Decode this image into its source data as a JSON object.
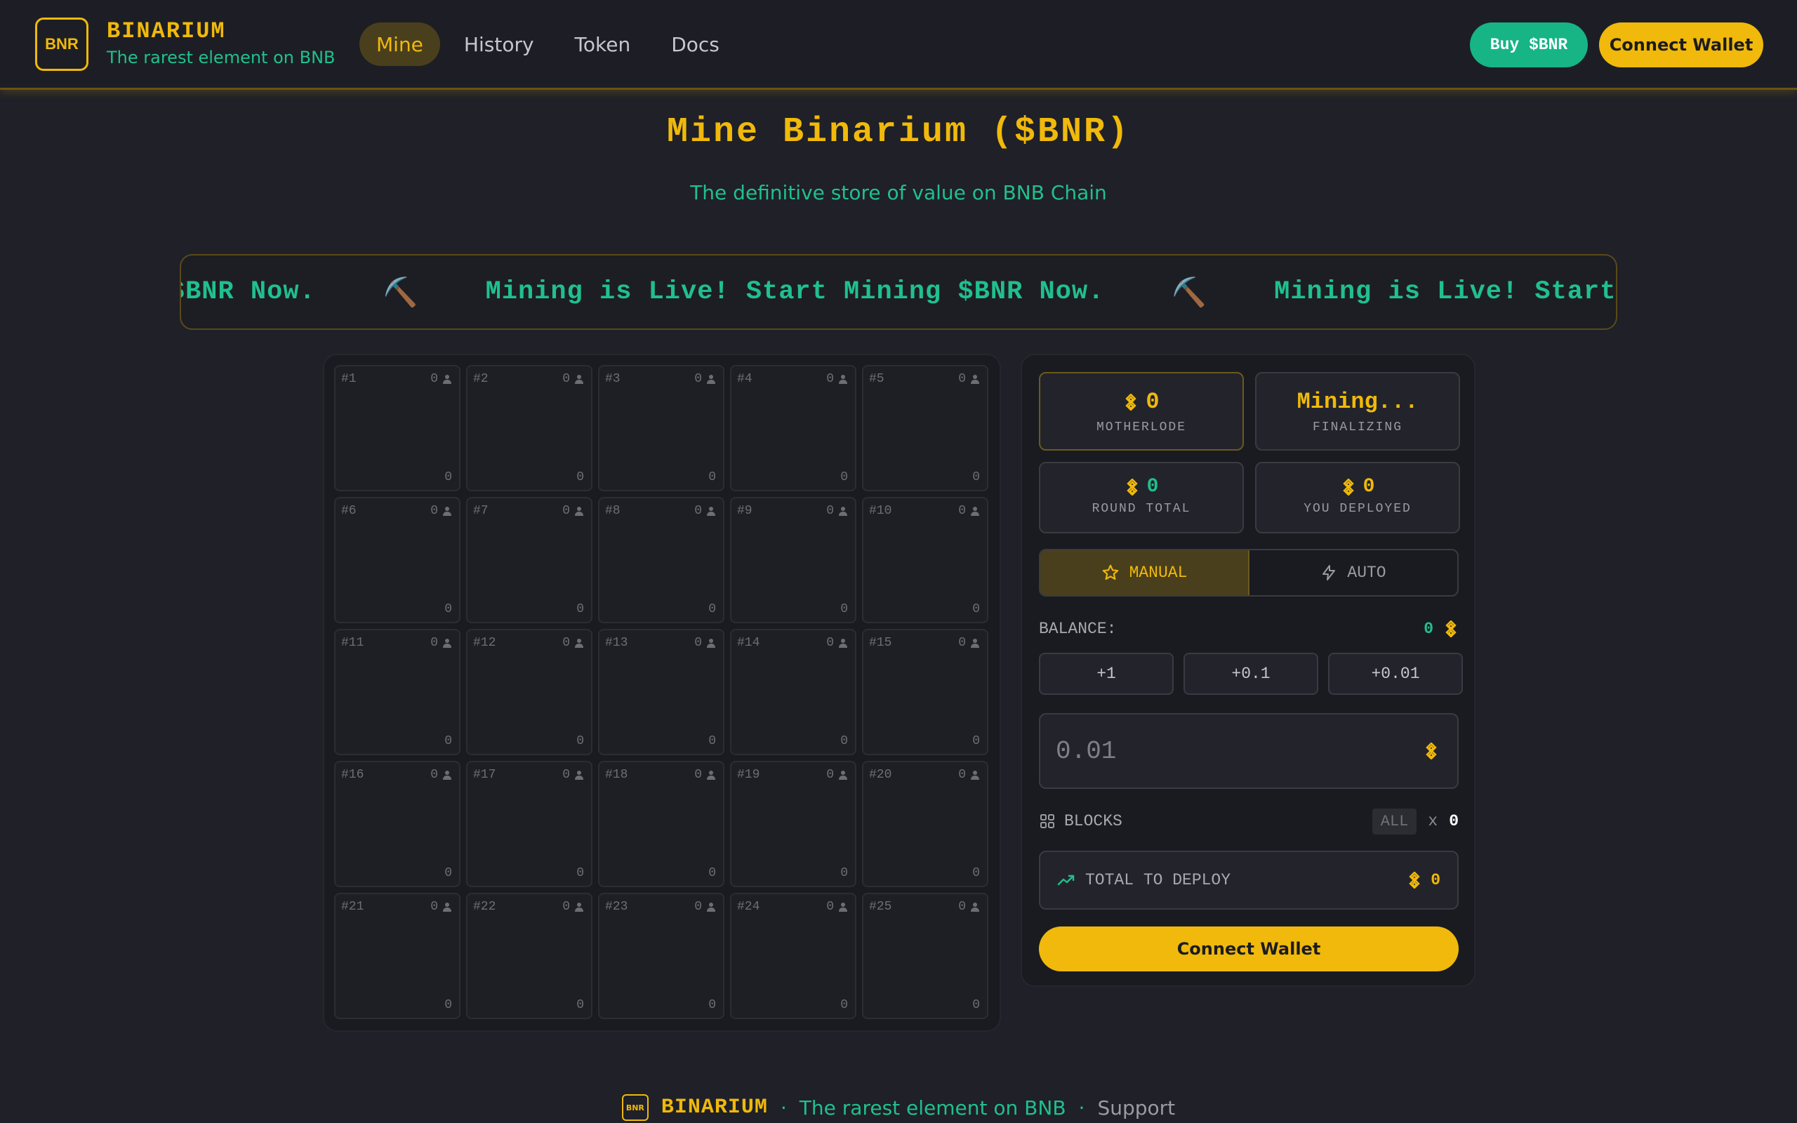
{
  "header": {
    "logo_text": "BNR",
    "brand_name": "BINARIUM",
    "tagline": "The rarest element on BNB",
    "nav": [
      {
        "label": "Mine",
        "active": true
      },
      {
        "label": "History",
        "active": false
      },
      {
        "label": "Token",
        "active": false
      },
      {
        "label": "Docs",
        "active": false
      }
    ],
    "buy_label": "Buy $BNR",
    "connect_label": "Connect Wallet"
  },
  "hero": {
    "title": "Mine Binarium ($BNR)",
    "subtitle": "The definitive store of value on BNB Chain"
  },
  "ticker": {
    "text": "Mining is Live! Start Mining $BNR Now.",
    "icon": "⛏️"
  },
  "grid": {
    "cells": [
      {
        "id": "#1",
        "miners": "0",
        "amount": "0"
      },
      {
        "id": "#2",
        "miners": "0",
        "amount": "0"
      },
      {
        "id": "#3",
        "miners": "0",
        "amount": "0"
      },
      {
        "id": "#4",
        "miners": "0",
        "amount": "0"
      },
      {
        "id": "#5",
        "miners": "0",
        "amount": "0"
      },
      {
        "id": "#6",
        "miners": "0",
        "amount": "0"
      },
      {
        "id": "#7",
        "miners": "0",
        "amount": "0"
      },
      {
        "id": "#8",
        "miners": "0",
        "amount": "0"
      },
      {
        "id": "#9",
        "miners": "0",
        "amount": "0"
      },
      {
        "id": "#10",
        "miners": "0",
        "amount": "0"
      },
      {
        "id": "#11",
        "miners": "0",
        "amount": "0"
      },
      {
        "id": "#12",
        "miners": "0",
        "amount": "0"
      },
      {
        "id": "#13",
        "miners": "0",
        "amount": "0"
      },
      {
        "id": "#14",
        "miners": "0",
        "amount": "0"
      },
      {
        "id": "#15",
        "miners": "0",
        "amount": "0"
      },
      {
        "id": "#16",
        "miners": "0",
        "amount": "0"
      },
      {
        "id": "#17",
        "miners": "0",
        "amount": "0"
      },
      {
        "id": "#18",
        "miners": "0",
        "amount": "0"
      },
      {
        "id": "#19",
        "miners": "0",
        "amount": "0"
      },
      {
        "id": "#20",
        "miners": "0",
        "amount": "0"
      },
      {
        "id": "#21",
        "miners": "0",
        "amount": "0"
      },
      {
        "id": "#22",
        "miners": "0",
        "amount": "0"
      },
      {
        "id": "#23",
        "miners": "0",
        "amount": "0"
      },
      {
        "id": "#24",
        "miners": "0",
        "amount": "0"
      },
      {
        "id": "#25",
        "miners": "0",
        "amount": "0"
      }
    ]
  },
  "panel": {
    "motherlode": {
      "value": "0",
      "label": "MOTHERLODE"
    },
    "status": {
      "value": "Mining...",
      "label": "FINALIZING"
    },
    "round_total": {
      "value": "0",
      "label": "ROUND TOTAL"
    },
    "you_deployed": {
      "value": "0",
      "label": "YOU DEPLOYED"
    },
    "modes": {
      "manual": "MANUAL",
      "auto": "AUTO"
    },
    "balance": {
      "label": "BALANCE:",
      "value": "0"
    },
    "increments": [
      "+1",
      "+0.1",
      "+0.01"
    ],
    "amount_placeholder": "0.01",
    "blocks": {
      "label": "BLOCKS",
      "all_label": "ALL",
      "x": "x",
      "count": "0"
    },
    "total": {
      "label": "TOTAL TO DEPLOY",
      "value": "0"
    },
    "connect_label": "Connect Wallet"
  },
  "footer": {
    "logo_text": "BNR",
    "brand_name": "BINARIUM",
    "separator": "·",
    "tagline": "The rarest element on BNB",
    "support": "Support"
  },
  "colors": {
    "accent": "#f0b90b",
    "green": "#20c08d",
    "background": "#1f2028"
  }
}
